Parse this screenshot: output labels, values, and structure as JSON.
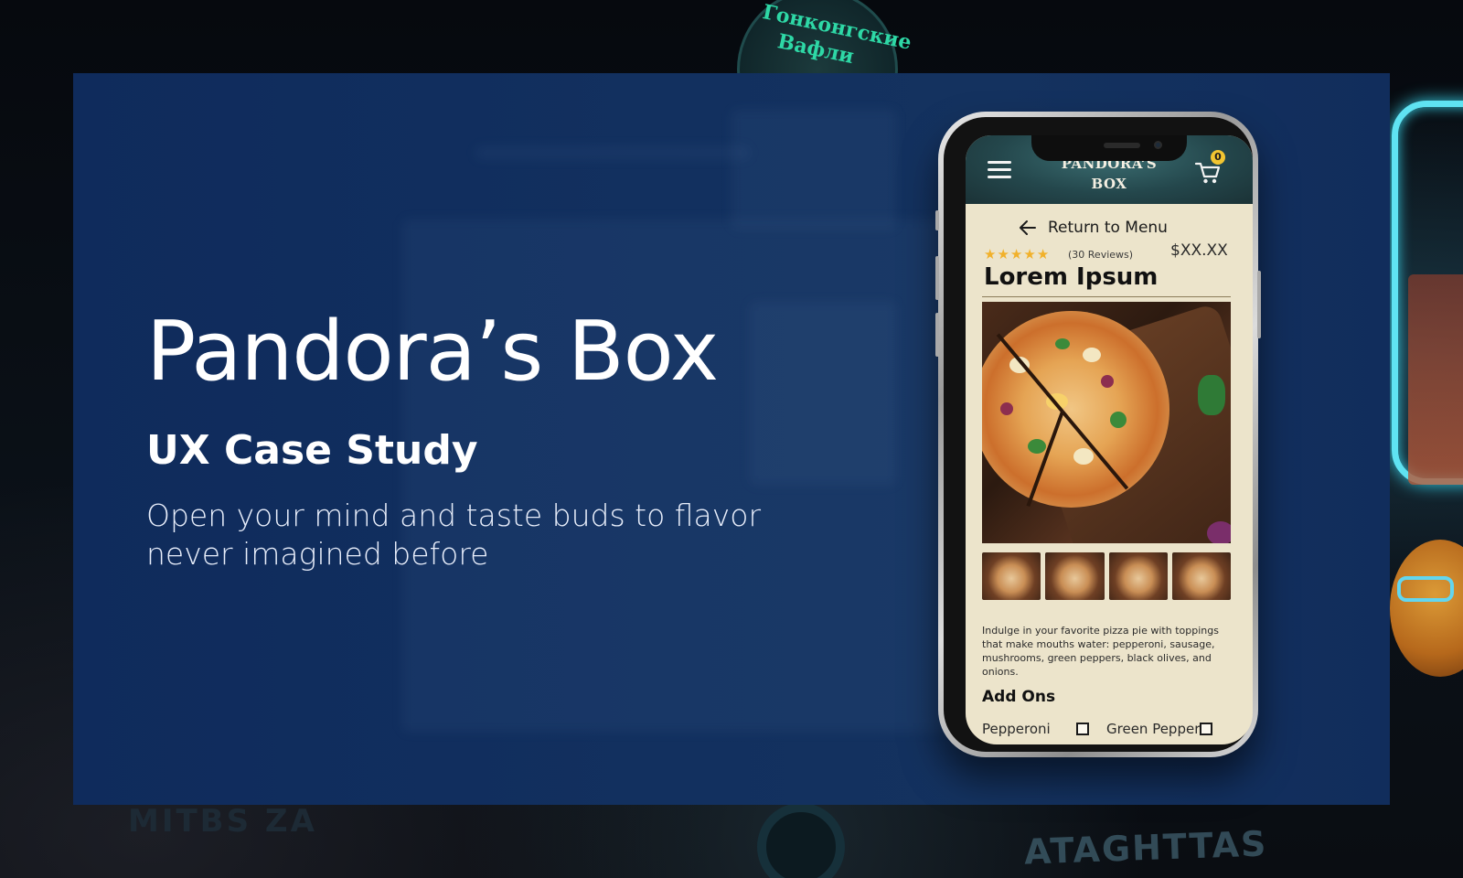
{
  "slide": {
    "title": "Pandora’s Box",
    "subtitle": "UX Case Study",
    "tagline": "Open your mind and taste buds to flavor never imagined before"
  },
  "background": {
    "medallion_text": "Гонконгские Вафли",
    "bottom_sign_text": "ATAGHTTAS",
    "bottom_left_text": "MITBS ZA"
  },
  "app": {
    "brand": "PANDORA’S BOX",
    "cart_count": "0",
    "return_label": "Return to Menu",
    "rating": 5,
    "reviews_label": "(30 Reviews)",
    "price": "$XX.XX",
    "item_title": "Lorem Ipsum",
    "description": "Indulge in your favorite pizza pie with toppings that make mouths water: pepperoni, sausage, mushrooms, green peppers, black olives, and onions.",
    "addons_title": "Add Ons",
    "addons": [
      {
        "label": "Pepperoni",
        "checked": false
      },
      {
        "label": "Green Pepper",
        "checked": false
      }
    ]
  },
  "colors": {
    "panel": "#12305f",
    "app_bg": "#ece4cb",
    "header": "#24474c",
    "star": "#f1b12b",
    "badge": "#f2c531"
  },
  "icons": [
    "menu-icon",
    "cart-icon",
    "arrow-left-icon",
    "star-icon"
  ]
}
